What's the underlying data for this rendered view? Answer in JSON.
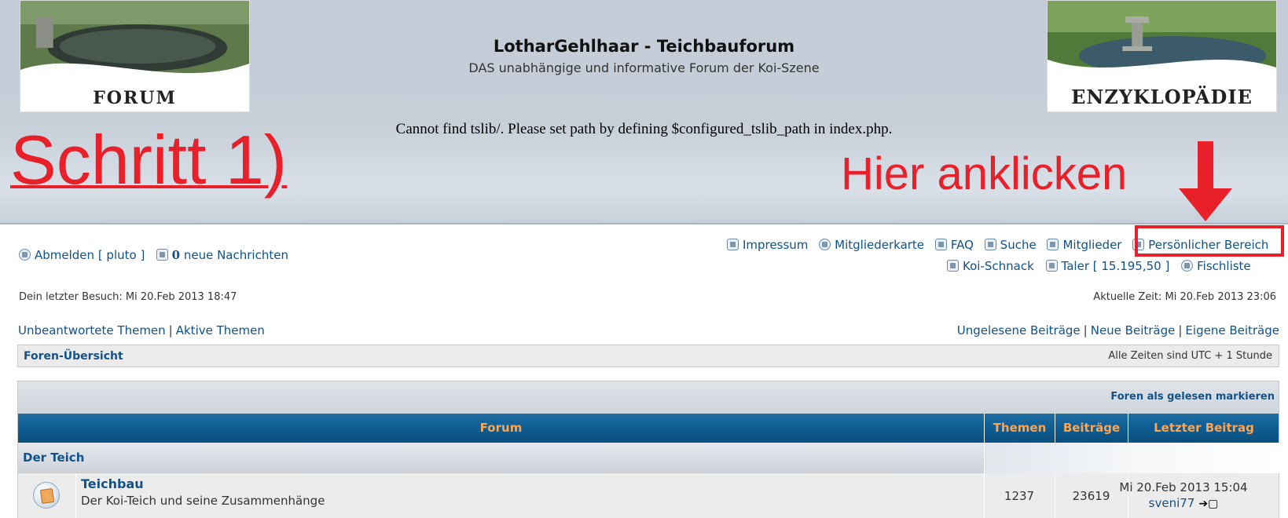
{
  "header": {
    "title": "LotharGehlhaar - Teichbauforum",
    "description": "DAS unabhängige und informative Forum der Koi-Szene",
    "error_message": "Cannot find tslib/. Please set path by defining $configured_tslib_path in index.php.",
    "logo_left_text": "FORUM",
    "logo_right_text": "ENZYKLOPÄDIE"
  },
  "annotations": {
    "step": "Schritt 1)",
    "instruction": "Hier anklicken",
    "color": "#e8202a"
  },
  "user": {
    "logout_label": "Abmelden [ pluto ]",
    "messages_count": "0",
    "messages_label": "neue Nachrichten",
    "last_visit": "Dein letzter Besuch: Mi 20.Feb 2013 18:47",
    "current_time": "Aktuelle Zeit: Mi 20.Feb 2013 23:06"
  },
  "nav": {
    "impressum": "Impressum",
    "member_map": "Mitgliederkarte",
    "faq": "FAQ",
    "search": "Suche",
    "members": "Mitglieder",
    "personal_area": "Persönlicher Bereich",
    "koi_schnack": "Koi-Schnack",
    "taler": "Taler [ 15.195,50 ]",
    "fish_list": "Fischliste"
  },
  "quick_links": {
    "unanswered": "Unbeantwortete Themen",
    "active": "Aktive Themen",
    "unread": "Ungelesene Beiträge",
    "new_posts": "Neue Beiträge",
    "own_posts": "Eigene Beiträge",
    "separator": "|"
  },
  "breadcrumbs": {
    "home": "Foren-Übersicht",
    "timezone": "Alle Zeiten sind UTC + 1 Stunde"
  },
  "forum_table": {
    "mark_read": "Foren als gelesen markieren",
    "columns": [
      "Forum",
      "Themen",
      "Beiträge",
      "Letzter Beitrag"
    ],
    "category": "Der Teich",
    "forums": [
      {
        "name": "Teichbau",
        "description": "Der Koi-Teich und seine Zusammenhänge",
        "topics": "1237",
        "posts": "23619",
        "last_post_date": "Mi 20.Feb 2013 15:04",
        "last_post_user": "sveni77"
      }
    ],
    "header_color": "#0f5e93",
    "header_text_color": "#ffa34f"
  }
}
